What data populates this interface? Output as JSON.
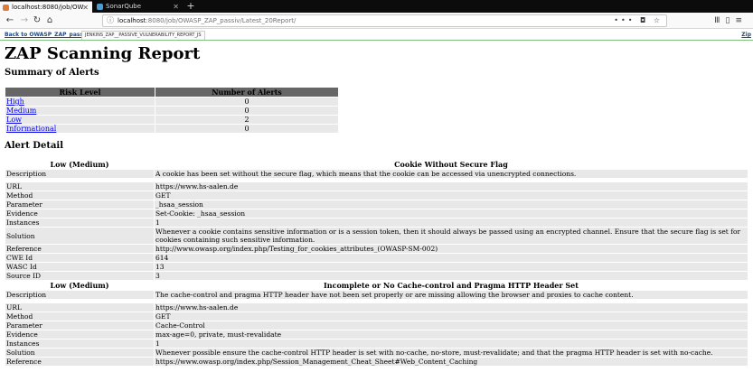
{
  "browser": {
    "tabs": [
      {
        "label": "localhost:8080/job/OW",
        "active": true
      },
      {
        "label": "SonarQube",
        "active": false
      }
    ],
    "url_host": "localhost",
    "url_path": ":8080/job/OWASP_ZAP_passiv/Latest_20Report/"
  },
  "jenkins": {
    "back_label": "Back to OWASP_ZAP_passiv",
    "report_name": "JENKINS_ZAP__PASSIVE_VULNERABILITY_REPORT_JS",
    "zip_label": "Zip"
  },
  "report": {
    "title": "ZAP Scanning Report",
    "summary_heading": "Summary of Alerts",
    "summary_headers": [
      "Risk Level",
      "Number of Alerts"
    ],
    "summary_rows": [
      {
        "level": "High",
        "count": "0"
      },
      {
        "level": "Medium",
        "count": "0"
      },
      {
        "level": "Low",
        "count": "2"
      },
      {
        "level": "Informational",
        "count": "0"
      }
    ],
    "detail_heading": "Alert Detail",
    "alerts": [
      {
        "risk": "Low (Medium)",
        "name": "Cookie Without Secure Flag",
        "description": "A cookie has been set without the secure flag, which means that the cookie can be accessed via unencrypted connections.",
        "url": "https://www.hs-aalen.de",
        "method": "GET",
        "parameter": "_hsaa_session",
        "evidence": "Set-Cookie: _hsaa_session",
        "instances": "1",
        "solution": "Whenever a cookie contains sensitive information or is a session token, then it should always be passed using an encrypted channel. Ensure that the secure flag is set for cookies containing such sensitive information.",
        "reference": "http://www.owasp.org/index.php/Testing_for_cookies_attributes_(OWASP-SM-002)",
        "cwe": "614",
        "wasc": "13",
        "source": "3"
      },
      {
        "risk": "Low (Medium)",
        "name": "Incomplete or No Cache-control and Pragma HTTP Header Set",
        "description": "The cache-control and pragma HTTP header have not been set properly or are missing allowing the browser and proxies to cache content.",
        "url": "https://www.hs-aalen.de",
        "method": "GET",
        "parameter": "Cache-Control",
        "evidence": "max-age=0, private, must-revalidate",
        "instances": "1",
        "solution": "Whenever possible ensure the cache-control HTTP header is set with no-cache, no-store, must-revalidate; and that the pragma HTTP header is set with no-cache.",
        "reference": "https://www.owasp.org/index.php/Session_Management_Cheat_Sheet#Web_Content_Caching"
      }
    ],
    "labels": {
      "description": "Description",
      "url": "URL",
      "method": "Method",
      "parameter": "Parameter",
      "evidence": "Evidence",
      "instances": "Instances",
      "solution": "Solution",
      "reference": "Reference",
      "cwe": "CWE Id",
      "wasc": "WASC Id",
      "source": "Source ID"
    }
  }
}
